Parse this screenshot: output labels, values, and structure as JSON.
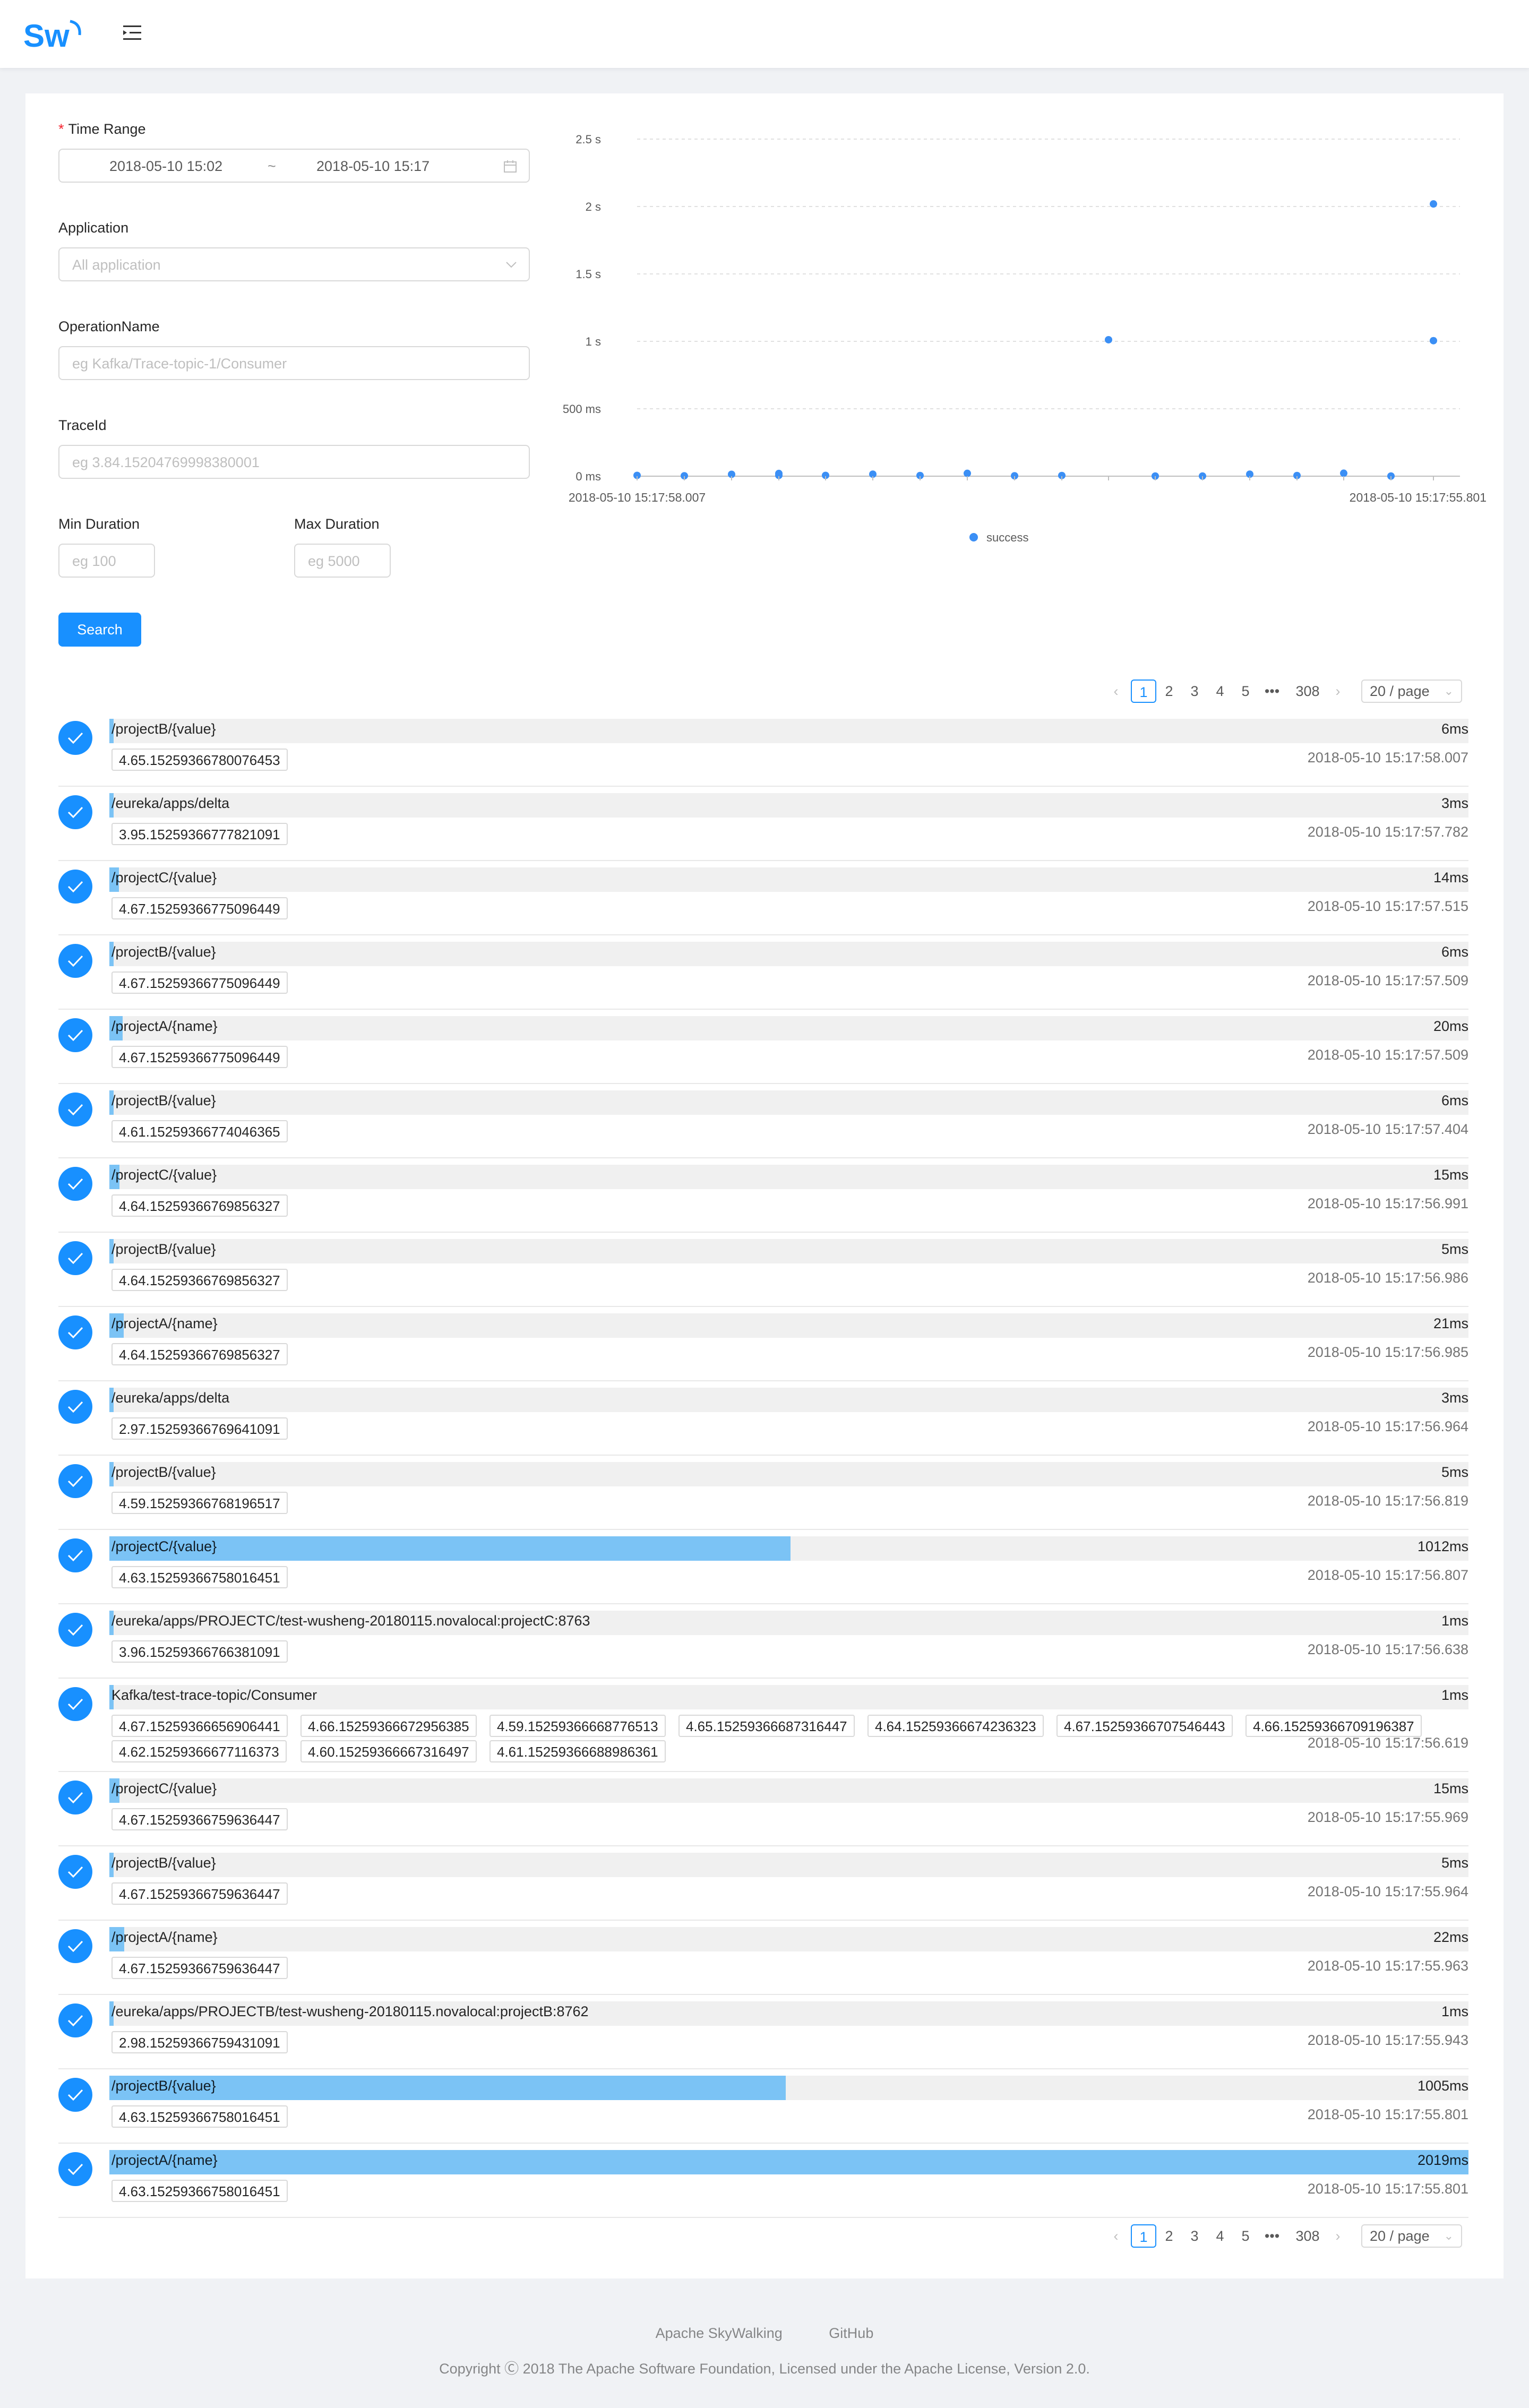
{
  "brand": {
    "logo_text": "Sw",
    "color": "#1890ff"
  },
  "form": {
    "time_range_label": "Time Range",
    "time_start": "2018-05-10 15:02",
    "time_sep": "~",
    "time_end": "2018-05-10 15:17",
    "application_label": "Application",
    "application_placeholder": "All application",
    "operation_label": "OperationName",
    "operation_placeholder": "eg Kafka/Trace-topic-1/Consumer",
    "traceid_label": "TraceId",
    "traceid_placeholder": "eg 3.84.15204769998380001",
    "min_label": "Min Duration",
    "min_placeholder": "eg 100",
    "max_label": "Max Duration",
    "max_placeholder": "eg 5000",
    "search_label": "Search"
  },
  "chart_data": {
    "type": "scatter",
    "y_ticks": [
      "0 ms",
      "500 ms",
      "1 s",
      "1.5 s",
      "2 s",
      "2.5 s"
    ],
    "ylim": [
      0,
      2500
    ],
    "x_start_label": "2018-05-10 15:17:58.007",
    "x_end_label": "2018-05-10 15:17:55.801",
    "legend": "success",
    "point_color": "#3b8ff5",
    "grid": true,
    "points": [
      {
        "x": 0,
        "y": 6
      },
      {
        "x": 1,
        "y": 3
      },
      {
        "x": 2,
        "y": 14
      },
      {
        "x": 3,
        "y": 6
      },
      {
        "x": 3,
        "y": 20
      },
      {
        "x": 4,
        "y": 6
      },
      {
        "x": 5,
        "y": 15
      },
      {
        "x": 6,
        "y": 5
      },
      {
        "x": 7,
        "y": 21
      },
      {
        "x": 8,
        "y": 3
      },
      {
        "x": 9,
        "y": 5
      },
      {
        "x": 10,
        "y": 1012
      },
      {
        "x": 11,
        "y": 1
      },
      {
        "x": 12,
        "y": 1
      },
      {
        "x": 13,
        "y": 15
      },
      {
        "x": 14,
        "y": 5
      },
      {
        "x": 15,
        "y": 22
      },
      {
        "x": 16,
        "y": 1
      },
      {
        "x": 17,
        "y": 1005
      },
      {
        "x": 17,
        "y": 2019
      }
    ]
  },
  "pagination": {
    "prev": "‹",
    "next": "›",
    "pages": [
      "1",
      "2",
      "3",
      "4",
      "5"
    ],
    "ellipsis": "•••",
    "last": "308",
    "page_size": "20 / page"
  },
  "traces": [
    {
      "op": "/projectB/{value}",
      "duration": "6ms",
      "ms": 6,
      "time": "2018-05-10 15:17:58.007",
      "ids": [
        "4.65.15259366780076453"
      ]
    },
    {
      "op": "/eureka/apps/delta",
      "duration": "3ms",
      "ms": 3,
      "time": "2018-05-10 15:17:57.782",
      "ids": [
        "3.95.15259366777821091"
      ]
    },
    {
      "op": "/projectC/{value}",
      "duration": "14ms",
      "ms": 14,
      "time": "2018-05-10 15:17:57.515",
      "ids": [
        "4.67.15259366775096449"
      ]
    },
    {
      "op": "/projectB/{value}",
      "duration": "6ms",
      "ms": 6,
      "time": "2018-05-10 15:17:57.509",
      "ids": [
        "4.67.15259366775096449"
      ]
    },
    {
      "op": "/projectA/{name}",
      "duration": "20ms",
      "ms": 20,
      "time": "2018-05-10 15:17:57.509",
      "ids": [
        "4.67.15259366775096449"
      ]
    },
    {
      "op": "/projectB/{value}",
      "duration": "6ms",
      "ms": 6,
      "time": "2018-05-10 15:17:57.404",
      "ids": [
        "4.61.15259366774046365"
      ]
    },
    {
      "op": "/projectC/{value}",
      "duration": "15ms",
      "ms": 15,
      "time": "2018-05-10 15:17:56.991",
      "ids": [
        "4.64.15259366769856327"
      ]
    },
    {
      "op": "/projectB/{value}",
      "duration": "5ms",
      "ms": 5,
      "time": "2018-05-10 15:17:56.986",
      "ids": [
        "4.64.15259366769856327"
      ]
    },
    {
      "op": "/projectA/{name}",
      "duration": "21ms",
      "ms": 21,
      "time": "2018-05-10 15:17:56.985",
      "ids": [
        "4.64.15259366769856327"
      ]
    },
    {
      "op": "/eureka/apps/delta",
      "duration": "3ms",
      "ms": 3,
      "time": "2018-05-10 15:17:56.964",
      "ids": [
        "2.97.15259366769641091"
      ]
    },
    {
      "op": "/projectB/{value}",
      "duration": "5ms",
      "ms": 5,
      "time": "2018-05-10 15:17:56.819",
      "ids": [
        "4.59.15259366768196517"
      ]
    },
    {
      "op": "/projectC/{value}",
      "duration": "1012ms",
      "ms": 1012,
      "time": "2018-05-10 15:17:56.807",
      "ids": [
        "4.63.15259366758016451"
      ]
    },
    {
      "op": "/eureka/apps/PROJECTC/test-wusheng-20180115.novalocal:projectC:8763",
      "duration": "1ms",
      "ms": 1,
      "time": "2018-05-10 15:17:56.638",
      "ids": [
        "3.96.15259366766381091"
      ]
    },
    {
      "op": "Kafka/test-trace-topic/Consumer",
      "duration": "1ms",
      "ms": 1,
      "time": "2018-05-10 15:17:56.619",
      "ids": [
        "4.67.15259366656906441",
        "4.66.15259366672956385",
        "4.59.15259366668776513",
        "4.65.15259366687316447",
        "4.64.15259366674236323",
        "4.67.15259366707546443",
        "4.66.15259366709196387",
        "4.62.15259366677116373",
        "4.60.15259366667316497",
        "4.61.15259366688986361"
      ]
    },
    {
      "op": "/projectC/{value}",
      "duration": "15ms",
      "ms": 15,
      "time": "2018-05-10 15:17:55.969",
      "ids": [
        "4.67.15259366759636447"
      ]
    },
    {
      "op": "/projectB/{value}",
      "duration": "5ms",
      "ms": 5,
      "time": "2018-05-10 15:17:55.964",
      "ids": [
        "4.67.15259366759636447"
      ]
    },
    {
      "op": "/projectA/{name}",
      "duration": "22ms",
      "ms": 22,
      "time": "2018-05-10 15:17:55.963",
      "ids": [
        "4.67.15259366759636447"
      ]
    },
    {
      "op": "/eureka/apps/PROJECTB/test-wusheng-20180115.novalocal:projectB:8762",
      "duration": "1ms",
      "ms": 1,
      "time": "2018-05-10 15:17:55.943",
      "ids": [
        "2.98.15259366759431091"
      ]
    },
    {
      "op": "/projectB/{value}",
      "duration": "1005ms",
      "ms": 1005,
      "time": "2018-05-10 15:17:55.801",
      "ids": [
        "4.63.15259366758016451"
      ]
    },
    {
      "op": "/projectA/{name}",
      "duration": "2019ms",
      "ms": 2019,
      "time": "2018-05-10 15:17:55.801",
      "ids": [
        "4.63.15259366758016451"
      ]
    }
  ],
  "footer": {
    "link_skywalking": "Apache SkyWalking",
    "link_github": "GitHub",
    "copyright": "Copyright Ⓒ 2018 The Apache Software Foundation, Licensed under the Apache License, Version 2.0."
  }
}
